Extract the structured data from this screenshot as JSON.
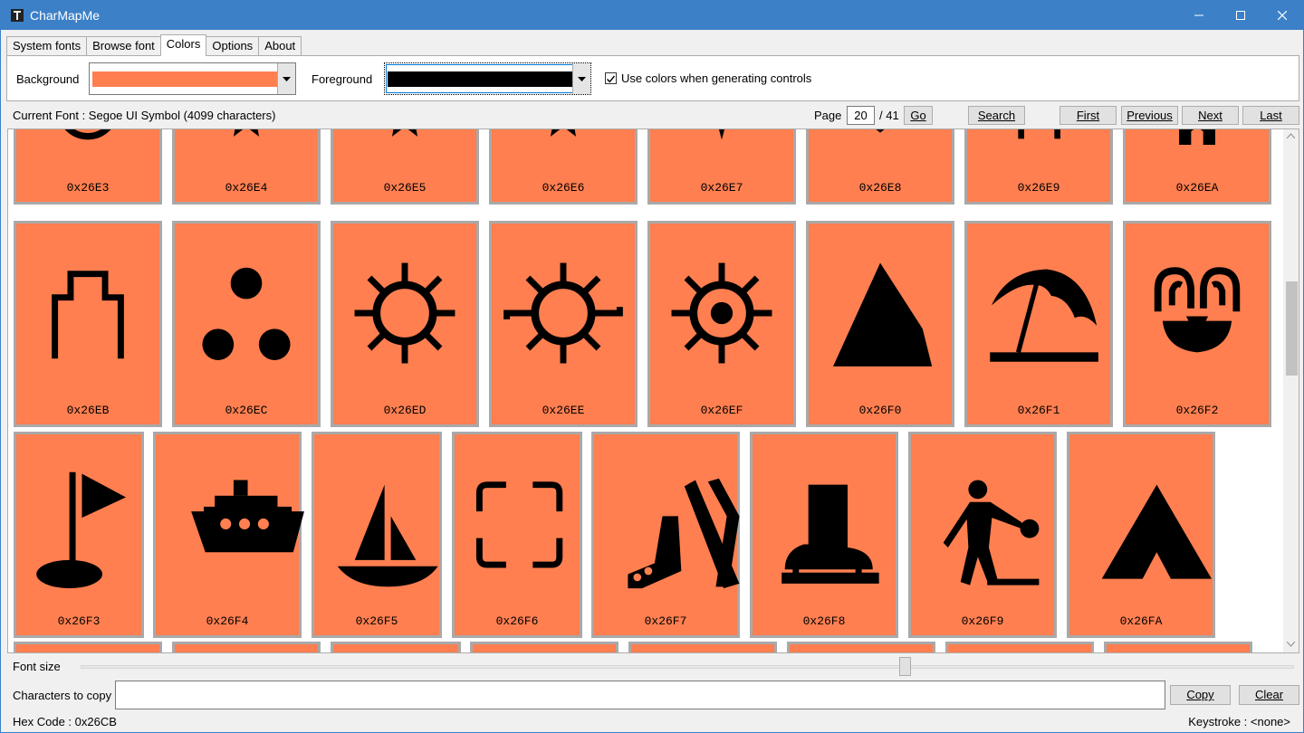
{
  "window": {
    "title": "CharMapMe",
    "controls": [
      "minimize",
      "maximize",
      "close"
    ]
  },
  "tabs": [
    {
      "label": "System fonts",
      "active": false
    },
    {
      "label": "Browse font",
      "active": false
    },
    {
      "label": "Colors",
      "active": true
    },
    {
      "label": "Options",
      "active": false
    },
    {
      "label": "About",
      "active": false
    }
  ],
  "colors_panel": {
    "background_label": "Background",
    "background_color": "#ff7f50",
    "foreground_label": "Foreground",
    "foreground_color": "#000000",
    "use_colors_label": "Use colors when generating controls",
    "use_colors_checked": true
  },
  "info": {
    "current_font": "Current Font : Segoe UI Symbol (4099 characters)",
    "page_label": "Page",
    "page_value": "20",
    "page_total": "/ 41",
    "go_label": "Go",
    "search_label": "Search",
    "first_label": "First",
    "previous_label": "Previous",
    "next_label": "Next",
    "last_label": "Last"
  },
  "grid": {
    "cell_color": "#ff7f50",
    "row1": [
      {
        "code": "0x26E3",
        "icon": "circle-icon"
      },
      {
        "code": "0x26E4",
        "icon": "pentagram-icon"
      },
      {
        "code": "0x26E5",
        "icon": "pentagram-icon"
      },
      {
        "code": "0x26E6",
        "icon": "pentagram-icon"
      },
      {
        "code": "0x26E7",
        "icon": "inverted-pentagram-icon"
      },
      {
        "code": "0x26E8",
        "icon": "shield-icon"
      },
      {
        "code": "0x26E9",
        "icon": "shrine-icon"
      },
      {
        "code": "0x26EA",
        "icon": "church-icon"
      }
    ],
    "row2": [
      {
        "code": "0x26EB",
        "icon": "castle-icon"
      },
      {
        "code": "0x26EC",
        "icon": "historic-site-icon"
      },
      {
        "code": "0x26ED",
        "icon": "gear-no-hub-icon"
      },
      {
        "code": "0x26EE",
        "icon": "gear-with-handles-icon"
      },
      {
        "code": "0x26EF",
        "icon": "map-symbol-lighthouse-icon"
      },
      {
        "code": "0x26F0",
        "icon": "mountain-icon"
      },
      {
        "code": "0x26F1",
        "icon": "beach-umbrella-icon"
      },
      {
        "code": "0x26F2",
        "icon": "fountain-icon"
      }
    ],
    "row3": [
      {
        "code": "0x26F3",
        "icon": "golf-flag-icon"
      },
      {
        "code": "0x26F4",
        "icon": "ferry-icon"
      },
      {
        "code": "0x26F5",
        "icon": "sailboat-icon"
      },
      {
        "code": "0x26F6",
        "icon": "square-four-corners-icon"
      },
      {
        "code": "0x26F7",
        "icon": "skier-icon"
      },
      {
        "code": "0x26F8",
        "icon": "ice-skate-icon"
      },
      {
        "code": "0x26F9",
        "icon": "person-with-ball-icon"
      },
      {
        "code": "0x26FA",
        "icon": "tent-icon"
      }
    ]
  },
  "footer": {
    "font_size_label": "Font size",
    "font_size_level": 0.68,
    "chars_label": "Characters to copy",
    "chars_value": "",
    "copy_label": "Copy",
    "clear_label": "Clear",
    "hex_code": "Hex Code : 0x26CB",
    "keystroke": "Keystroke : <none>"
  }
}
